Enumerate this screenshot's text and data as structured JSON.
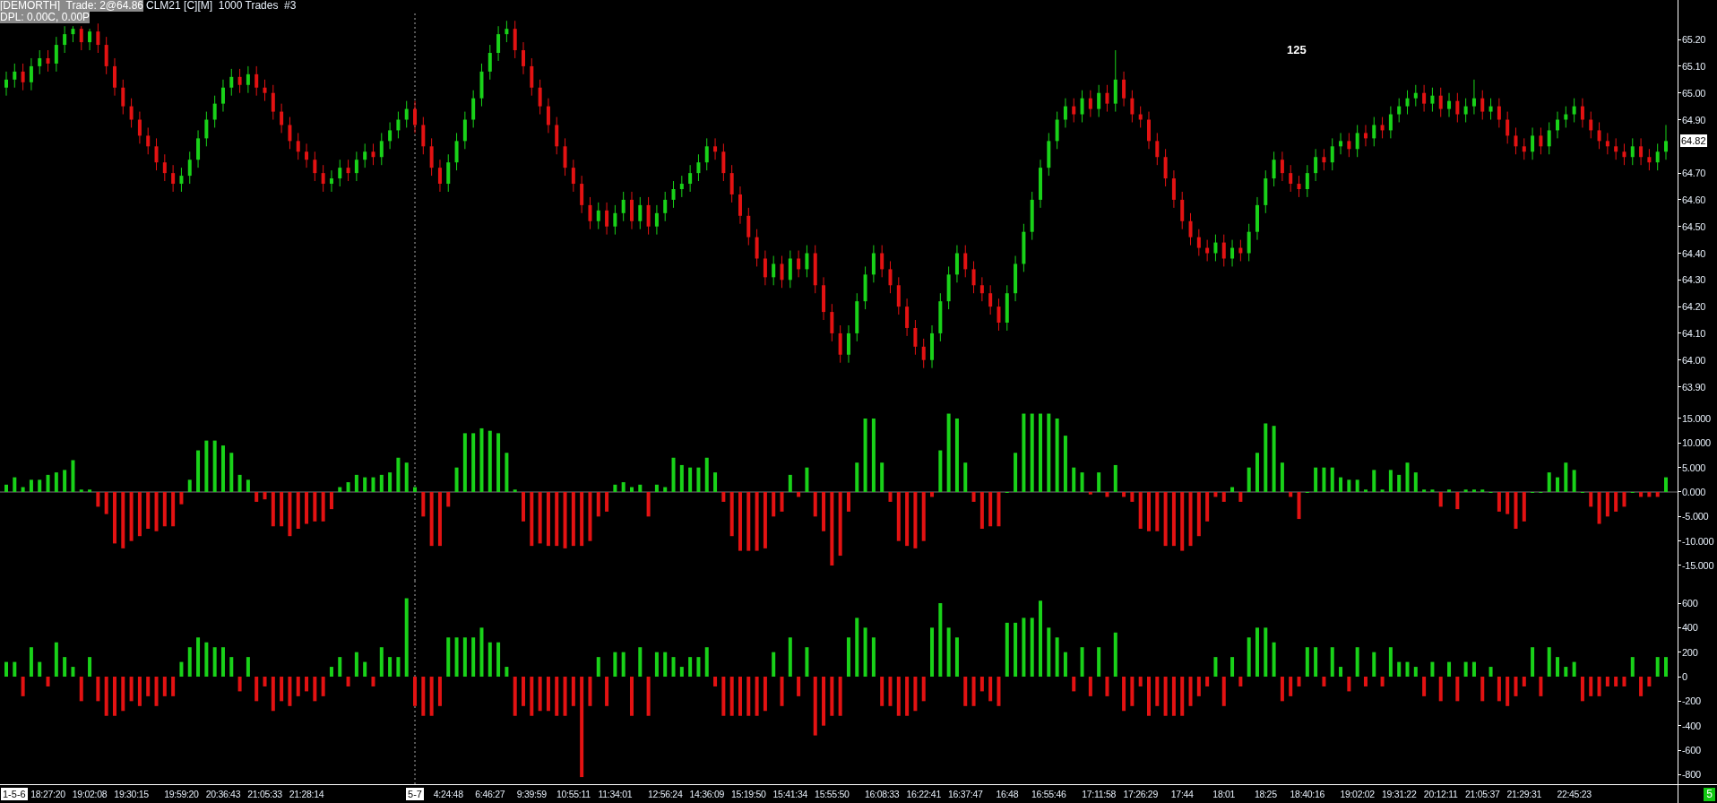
{
  "header": {
    "account_trade": "[DEMORTH]  Trade: 2@64.86",
    "symbol_info": "CLM21 [C][M]  1000 Trades  #3",
    "dpl": "DPL: 0.00C, 0.00P"
  },
  "bar_counter": "125",
  "price_pane": {
    "current_price": "64.82",
    "chart_data": {
      "type": "candlestick",
      "ylim": [
        63.885,
        65.348
      ],
      "yticks": [
        {
          "value": 65.2,
          "label": "65.20"
        },
        {
          "value": 65.1,
          "label": "65.10"
        },
        {
          "value": 65.0,
          "label": "65.00"
        },
        {
          "value": 64.9,
          "label": "64.90"
        },
        {
          "value": 64.7,
          "label": "64.70"
        },
        {
          "value": 64.6,
          "label": "64.60"
        },
        {
          "value": 64.5,
          "label": "64.50"
        },
        {
          "value": 64.4,
          "label": "64.40"
        },
        {
          "value": 64.3,
          "label": "64.30"
        },
        {
          "value": 64.2,
          "label": "64.20"
        },
        {
          "value": 64.1,
          "label": "64.10"
        },
        {
          "value": 64.0,
          "label": "64.00"
        },
        {
          "value": 63.9,
          "label": "63.90"
        }
      ],
      "categories": [
        null,
        null,
        null,
        null,
        null,
        null,
        null,
        null,
        null,
        null,
        null,
        null,
        null,
        null,
        null,
        null,
        null,
        null,
        null,
        null,
        null,
        null,
        null,
        null,
        null,
        null,
        null,
        null,
        null,
        null,
        null,
        null,
        null,
        null,
        null,
        null,
        null,
        null,
        null,
        null,
        null,
        null,
        null,
        null,
        null,
        null,
        null,
        null,
        null,
        null,
        null,
        null,
        null,
        null,
        null,
        null,
        null,
        null,
        null,
        null,
        null,
        null,
        null,
        null,
        null,
        null,
        null,
        null,
        null,
        null,
        null,
        null,
        null,
        null,
        null,
        null,
        null,
        null,
        null,
        null,
        null,
        null,
        null,
        null,
        null,
        null,
        null,
        null,
        null,
        null,
        null,
        null,
        null,
        null,
        null,
        null,
        null,
        null,
        null,
        null,
        null,
        null,
        null,
        null,
        null,
        null,
        null,
        null,
        null,
        null,
        null,
        null,
        null,
        null,
        null,
        null,
        null,
        null,
        null,
        null,
        null,
        null,
        null,
        null,
        null,
        null,
        null,
        null,
        null,
        null,
        null,
        null,
        null,
        null,
        null,
        null,
        null,
        null,
        null,
        null,
        null,
        null,
        null,
        null,
        null,
        null,
        null,
        null,
        null,
        null,
        null,
        null,
        null,
        null,
        null,
        null,
        null,
        null,
        null,
        null,
        null,
        null,
        null,
        null,
        null,
        null,
        null,
        null,
        null,
        null,
        null,
        null,
        null,
        null,
        null,
        null,
        null,
        null,
        null,
        null,
        null,
        null,
        null,
        null,
        null,
        null,
        null,
        null,
        null,
        null,
        null,
        null,
        null,
        null,
        null,
        null,
        null,
        null,
        null,
        null
      ],
      "ohlc": [
        [
          65.02,
          65.08,
          64.99,
          65.05
        ],
        [
          65.05,
          65.11,
          65.02,
          65.08
        ],
        [
          65.08,
          65.11,
          65.01,
          65.04
        ],
        [
          65.04,
          65.13,
          65.01,
          65.1
        ],
        [
          65.1,
          65.16,
          65.07,
          65.13
        ],
        [
          65.13,
          65.16,
          65.08,
          65.11
        ],
        [
          65.11,
          65.21,
          65.08,
          65.18
        ],
        [
          65.18,
          65.25,
          65.15,
          65.22
        ],
        [
          65.22,
          65.25,
          65.19,
          65.24
        ],
        [
          65.24,
          65.25,
          65.16,
          65.19
        ],
        [
          65.19,
          65.24,
          65.16,
          65.23
        ],
        [
          65.23,
          65.26,
          65.15,
          65.18
        ],
        [
          65.18,
          65.21,
          65.07,
          65.1
        ],
        [
          65.1,
          65.13,
          64.99,
          65.02
        ],
        [
          65.02,
          65.05,
          64.92,
          64.95
        ],
        [
          64.95,
          64.98,
          64.87,
          64.9
        ],
        [
          64.9,
          64.93,
          64.81,
          64.84
        ],
        [
          64.84,
          64.87,
          64.77,
          64.8
        ],
        [
          64.8,
          64.83,
          64.71,
          64.74
        ],
        [
          64.74,
          64.77,
          64.67,
          64.7
        ],
        [
          64.7,
          64.73,
          64.63,
          64.66
        ],
        [
          64.66,
          64.72,
          64.63,
          64.69
        ],
        [
          64.69,
          64.78,
          64.66,
          64.75
        ],
        [
          64.75,
          64.86,
          64.72,
          64.83
        ],
        [
          64.83,
          64.93,
          64.8,
          64.9
        ],
        [
          64.9,
          64.99,
          64.87,
          64.96
        ],
        [
          64.96,
          65.05,
          64.93,
          65.02
        ],
        [
          65.02,
          65.09,
          64.99,
          65.06
        ],
        [
          65.06,
          65.09,
          65.0,
          65.03
        ],
        [
          65.03,
          65.1,
          65.0,
          65.07
        ],
        [
          65.07,
          65.1,
          64.99,
          65.02
        ],
        [
          65.02,
          65.05,
          64.97,
          65.0
        ],
        [
          65.0,
          65.03,
          64.9,
          64.93
        ],
        [
          64.93,
          64.96,
          64.85,
          64.88
        ],
        [
          64.88,
          64.91,
          64.79,
          64.82
        ],
        [
          64.82,
          64.85,
          64.75,
          64.78
        ],
        [
          64.78,
          64.81,
          64.72,
          64.75
        ],
        [
          64.75,
          64.78,
          64.67,
          64.7
        ],
        [
          64.7,
          64.73,
          64.63,
          64.66
        ],
        [
          64.66,
          64.71,
          64.63,
          64.68
        ],
        [
          64.68,
          64.75,
          64.65,
          64.72
        ],
        [
          64.72,
          64.75,
          64.67,
          64.7
        ],
        [
          64.7,
          64.78,
          64.67,
          64.75
        ],
        [
          64.75,
          64.81,
          64.72,
          64.78
        ],
        [
          64.78,
          64.81,
          64.73,
          64.76
        ],
        [
          64.76,
          64.85,
          64.73,
          64.82
        ],
        [
          64.82,
          64.89,
          64.79,
          64.86
        ],
        [
          64.86,
          64.93,
          64.83,
          64.9
        ],
        [
          64.9,
          64.97,
          64.87,
          64.94
        ],
        [
          64.94,
          64.97,
          64.85,
          64.88
        ],
        [
          64.88,
          64.91,
          64.77,
          64.8
        ],
        [
          64.8,
          64.83,
          64.69,
          64.72
        ],
        [
          64.72,
          64.75,
          64.63,
          64.66
        ],
        [
          64.66,
          64.77,
          64.63,
          64.74
        ],
        [
          64.74,
          64.85,
          64.71,
          64.82
        ],
        [
          64.82,
          64.93,
          64.79,
          64.9
        ],
        [
          64.9,
          65.01,
          64.87,
          64.98
        ],
        [
          64.98,
          65.11,
          64.95,
          65.08
        ],
        [
          65.08,
          65.18,
          65.05,
          65.15
        ],
        [
          65.15,
          65.25,
          65.12,
          65.22
        ],
        [
          65.22,
          65.27,
          65.19,
          65.24
        ],
        [
          65.24,
          65.27,
          65.13,
          65.16
        ],
        [
          65.16,
          65.19,
          65.07,
          65.1
        ],
        [
          65.1,
          65.13,
          64.99,
          65.02
        ],
        [
          65.02,
          65.05,
          64.92,
          64.95
        ],
        [
          64.95,
          64.98,
          64.85,
          64.88
        ],
        [
          64.88,
          64.91,
          64.77,
          64.8
        ],
        [
          64.8,
          64.83,
          64.69,
          64.72
        ],
        [
          64.72,
          64.75,
          64.63,
          64.66
        ],
        [
          64.66,
          64.69,
          64.55,
          64.58
        ],
        [
          64.58,
          64.61,
          64.49,
          64.52
        ],
        [
          64.52,
          64.59,
          64.49,
          64.56
        ],
        [
          64.56,
          64.59,
          64.47,
          64.5
        ],
        [
          64.5,
          64.58,
          64.47,
          64.55
        ],
        [
          64.55,
          64.63,
          64.52,
          64.6
        ],
        [
          64.6,
          64.63,
          64.49,
          64.52
        ],
        [
          64.52,
          64.61,
          64.49,
          64.58
        ],
        [
          64.58,
          64.61,
          64.47,
          64.5
        ],
        [
          64.5,
          64.58,
          64.47,
          64.55
        ],
        [
          64.55,
          64.63,
          64.52,
          64.6
        ],
        [
          64.6,
          64.67,
          64.57,
          64.64
        ],
        [
          64.64,
          64.69,
          64.61,
          64.66
        ],
        [
          64.66,
          64.73,
          64.63,
          64.7
        ],
        [
          64.7,
          64.77,
          64.67,
          64.74
        ],
        [
          64.74,
          64.83,
          64.71,
          64.8
        ],
        [
          64.8,
          64.83,
          64.75,
          64.78
        ],
        [
          64.78,
          64.81,
          64.67,
          64.7
        ],
        [
          64.7,
          64.73,
          64.59,
          64.62
        ],
        [
          64.62,
          64.65,
          64.51,
          64.54
        ],
        [
          64.54,
          64.57,
          64.43,
          64.46
        ],
        [
          64.46,
          64.49,
          64.35,
          64.38
        ],
        [
          64.38,
          64.41,
          64.28,
          64.31
        ],
        [
          64.31,
          64.39,
          64.28,
          64.36
        ],
        [
          64.36,
          64.39,
          64.27,
          64.3
        ],
        [
          64.3,
          64.41,
          64.27,
          64.38
        ],
        [
          64.38,
          64.41,
          64.31,
          64.34
        ],
        [
          64.34,
          64.43,
          64.31,
          64.4
        ],
        [
          64.4,
          64.43,
          64.25,
          64.28
        ],
        [
          64.28,
          64.31,
          64.15,
          64.18
        ],
        [
          64.18,
          64.21,
          64.07,
          64.1
        ],
        [
          64.1,
          64.13,
          63.99,
          64.02
        ],
        [
          64.02,
          64.13,
          63.99,
          64.1
        ],
        [
          64.1,
          64.25,
          64.07,
          64.22
        ],
        [
          64.22,
          64.35,
          64.19,
          64.32
        ],
        [
          64.32,
          64.43,
          64.29,
          64.4
        ],
        [
          64.4,
          64.43,
          64.31,
          64.34
        ],
        [
          64.34,
          64.37,
          64.25,
          64.28
        ],
        [
          64.28,
          64.31,
          64.17,
          64.2
        ],
        [
          64.2,
          64.23,
          64.09,
          64.12
        ],
        [
          64.12,
          64.15,
          64.02,
          64.05
        ],
        [
          64.05,
          64.08,
          63.97,
          64.0
        ],
        [
          64.0,
          64.13,
          63.97,
          64.1
        ],
        [
          64.1,
          64.25,
          64.07,
          64.22
        ],
        [
          64.22,
          64.35,
          64.19,
          64.32
        ],
        [
          64.32,
          64.43,
          64.29,
          64.4
        ],
        [
          64.4,
          64.43,
          64.31,
          64.34
        ],
        [
          64.34,
          64.37,
          64.25,
          64.28
        ],
        [
          64.28,
          64.31,
          64.22,
          64.25
        ],
        [
          64.25,
          64.28,
          64.17,
          64.2
        ],
        [
          64.2,
          64.23,
          64.11,
          64.14
        ],
        [
          64.14,
          64.28,
          64.11,
          64.25
        ],
        [
          64.25,
          64.39,
          64.22,
          64.36
        ],
        [
          64.36,
          64.51,
          64.33,
          64.48
        ],
        [
          64.48,
          64.63,
          64.45,
          64.6
        ],
        [
          64.6,
          64.75,
          64.57,
          64.72
        ],
        [
          64.72,
          64.85,
          64.69,
          64.82
        ],
        [
          64.82,
          64.93,
          64.79,
          64.9
        ],
        [
          64.9,
          64.98,
          64.87,
          64.95
        ],
        [
          64.95,
          64.98,
          64.89,
          64.92
        ],
        [
          64.92,
          65.01,
          64.89,
          64.98
        ],
        [
          64.98,
          65.01,
          64.91,
          64.94
        ],
        [
          64.94,
          65.03,
          64.91,
          65.0
        ],
        [
          65.0,
          65.03,
          64.93,
          64.96
        ],
        [
          64.96,
          65.16,
          64.93,
          65.05
        ],
        [
          65.05,
          65.08,
          64.95,
          64.98
        ],
        [
          64.98,
          65.01,
          64.89,
          64.92
        ],
        [
          64.92,
          64.95,
          64.87,
          64.9
        ],
        [
          64.9,
          64.93,
          64.79,
          64.82
        ],
        [
          64.82,
          64.85,
          64.73,
          64.76
        ],
        [
          64.76,
          64.79,
          64.65,
          64.68
        ],
        [
          64.68,
          64.71,
          64.57,
          64.6
        ],
        [
          64.6,
          64.63,
          64.49,
          64.52
        ],
        [
          64.52,
          64.55,
          64.43,
          64.46
        ],
        [
          64.46,
          64.49,
          64.39,
          64.42
        ],
        [
          64.42,
          64.45,
          64.37,
          64.4
        ],
        [
          64.4,
          64.47,
          64.37,
          64.44
        ],
        [
          64.44,
          64.47,
          64.35,
          64.38
        ],
        [
          64.38,
          64.45,
          64.35,
          64.42
        ],
        [
          64.42,
          64.45,
          64.37,
          64.4
        ],
        [
          64.4,
          64.51,
          64.37,
          64.48
        ],
        [
          64.48,
          64.61,
          64.45,
          64.58
        ],
        [
          64.58,
          64.71,
          64.55,
          64.68
        ],
        [
          64.68,
          64.78,
          64.65,
          64.75
        ],
        [
          64.75,
          64.78,
          64.67,
          64.7
        ],
        [
          64.7,
          64.73,
          64.63,
          64.66
        ],
        [
          64.66,
          64.69,
          64.61,
          64.64
        ],
        [
          64.64,
          64.73,
          64.61,
          64.7
        ],
        [
          64.7,
          64.79,
          64.67,
          64.76
        ],
        [
          64.76,
          64.79,
          64.71,
          64.74
        ],
        [
          64.74,
          64.83,
          64.71,
          64.8
        ],
        [
          64.8,
          64.85,
          64.77,
          64.82
        ],
        [
          64.82,
          64.85,
          64.76,
          64.79
        ],
        [
          64.79,
          64.88,
          64.76,
          64.85
        ],
        [
          64.85,
          64.88,
          64.8,
          64.83
        ],
        [
          64.83,
          64.91,
          64.8,
          64.88
        ],
        [
          64.88,
          64.91,
          64.83,
          64.86
        ],
        [
          64.86,
          64.95,
          64.83,
          64.92
        ],
        [
          64.92,
          64.98,
          64.89,
          64.95
        ],
        [
          64.95,
          65.01,
          64.92,
          64.98
        ],
        [
          64.98,
          65.03,
          64.95,
          65.0
        ],
        [
          65.0,
          65.03,
          64.93,
          64.96
        ],
        [
          64.96,
          65.02,
          64.93,
          64.99
        ],
        [
          64.99,
          65.02,
          64.91,
          64.94
        ],
        [
          64.94,
          65.0,
          64.91,
          64.97
        ],
        [
          64.97,
          65.0,
          64.89,
          64.92
        ],
        [
          64.92,
          64.98,
          64.89,
          64.95
        ],
        [
          64.95,
          65.05,
          64.92,
          64.98
        ],
        [
          64.98,
          65.01,
          64.9,
          64.93
        ],
        [
          64.93,
          64.98,
          64.9,
          64.95
        ],
        [
          64.95,
          64.98,
          64.87,
          64.9
        ],
        [
          64.9,
          64.93,
          64.81,
          64.84
        ],
        [
          64.84,
          64.87,
          64.77,
          64.8
        ],
        [
          64.8,
          64.83,
          64.75,
          64.78
        ],
        [
          64.78,
          64.87,
          64.75,
          64.84
        ],
        [
          64.84,
          64.87,
          64.77,
          64.8
        ],
        [
          64.8,
          64.89,
          64.77,
          64.86
        ],
        [
          64.86,
          64.93,
          64.83,
          64.9
        ],
        [
          64.9,
          64.95,
          64.87,
          64.92
        ],
        [
          64.92,
          64.98,
          64.89,
          64.95
        ],
        [
          64.95,
          64.98,
          64.87,
          64.9
        ],
        [
          64.9,
          64.93,
          64.83,
          64.86
        ],
        [
          64.86,
          64.89,
          64.79,
          64.82
        ],
        [
          64.82,
          64.85,
          64.77,
          64.8
        ],
        [
          64.8,
          64.83,
          64.75,
          64.78
        ],
        [
          64.78,
          64.81,
          64.73,
          64.76
        ],
        [
          64.76,
          64.83,
          64.73,
          64.8
        ],
        [
          64.8,
          64.83,
          64.73,
          64.76
        ],
        [
          64.76,
          64.79,
          64.71,
          64.74
        ],
        [
          64.74,
          64.81,
          64.71,
          64.78
        ],
        [
          64.78,
          64.88,
          64.75,
          64.82
        ]
      ]
    }
  },
  "delta_pane": {
    "chart_data": {
      "type": "bar",
      "ylim": [
        -18.11,
        20.67
      ],
      "yticks": [
        {
          "value": 15,
          "label": "15.000"
        },
        {
          "value": 10,
          "label": "10.000"
        },
        {
          "value": 5,
          "label": "5.000"
        },
        {
          "value": 0,
          "label": "0.000"
        },
        {
          "value": -5,
          "label": "-5.000"
        },
        {
          "value": -10,
          "label": "-10.000"
        },
        {
          "value": -15,
          "label": "-15.000"
        }
      ],
      "categories": [
        null,
        null,
        null,
        null,
        null,
        null,
        null,
        null,
        null,
        null,
        null,
        null,
        null,
        null,
        null,
        null,
        null,
        null,
        null,
        null,
        null,
        null,
        null,
        null,
        null,
        null,
        null,
        null,
        null,
        null,
        null,
        null,
        null,
        null,
        null,
        null,
        null,
        null,
        null,
        null,
        null,
        null,
        null,
        null,
        null,
        null,
        null,
        null,
        null,
        null,
        null,
        null,
        null,
        null,
        null,
        null,
        null,
        null,
        null,
        null,
        null,
        null,
        null,
        null,
        null,
        null,
        null,
        null,
        null,
        null,
        null,
        null,
        null,
        null,
        null,
        null,
        null,
        null,
        null,
        null,
        null,
        null,
        null,
        null,
        null,
        null,
        null,
        null,
        null,
        null,
        null,
        null,
        null,
        null,
        null,
        null,
        null,
        null,
        null,
        null,
        null,
        null,
        null,
        null,
        null,
        null,
        null,
        null,
        null,
        null,
        null,
        null,
        null,
        null,
        null,
        null,
        null,
        null,
        null,
        null,
        null,
        null,
        null,
        null,
        null,
        null,
        null,
        null,
        null,
        null,
        null,
        null,
        null,
        null,
        null,
        null,
        null,
        null,
        null,
        null,
        null,
        null,
        null,
        null,
        null,
        null,
        null,
        null,
        null,
        null,
        null,
        null,
        null,
        null,
        null,
        null,
        null,
        null,
        null,
        null,
        null,
        null,
        null,
        null,
        null,
        null,
        null,
        null,
        null,
        null,
        null,
        null,
        null,
        null,
        null,
        null,
        null,
        null,
        null,
        null,
        null,
        null,
        null,
        null,
        null,
        null,
        null,
        null,
        null,
        null,
        null,
        null,
        null,
        null,
        null,
        null,
        null,
        null,
        null,
        null
      ],
      "values": [
        1.5,
        3,
        1,
        2.5,
        2.5,
        3.5,
        4,
        4.5,
        6.5,
        0.5,
        0.5,
        -3,
        -4.5,
        -10.5,
        -11.5,
        -10,
        -9,
        -7.5,
        -8,
        -7,
        -7,
        -2.5,
        2.5,
        8.5,
        10.5,
        10.5,
        9.5,
        8,
        3.5,
        2.5,
        -2,
        -1.5,
        -7,
        -7,
        -9,
        -7.5,
        -6.5,
        -6,
        -6,
        -3.5,
        1,
        2,
        3.5,
        3,
        3,
        3.5,
        4,
        7,
        6,
        1,
        -5,
        -11,
        -11,
        -3,
        5,
        12,
        12,
        13,
        12.5,
        12,
        8,
        0.5,
        -6,
        -11,
        -10.5,
        -11,
        -11,
        -11.5,
        -11,
        -11,
        -10,
        -5,
        -4,
        1.5,
        2,
        1,
        1.5,
        -5,
        1.5,
        1,
        7,
        5.5,
        5,
        5,
        7,
        4,
        -2,
        -9,
        -12,
        -12,
        -12,
        -11.5,
        -5,
        -4,
        3.5,
        -1,
        5,
        -5,
        -8,
        -15,
        -13,
        -4,
        6,
        15,
        15,
        6,
        -2,
        -10,
        -11,
        -11.5,
        -10,
        -1,
        8.5,
        16,
        15,
        6,
        -2,
        -7.5,
        -7,
        -7,
        0,
        8,
        16,
        16,
        16,
        16,
        15,
        11.5,
        5,
        4,
        -0.5,
        4,
        -1,
        5.5,
        -1,
        -2,
        -7.5,
        -8,
        -8,
        -11,
        -11,
        -12,
        -11,
        -9,
        -6,
        -1,
        -2,
        1,
        -2,
        5,
        8,
        14,
        13.5,
        6,
        -1,
        -5.5,
        0,
        5,
        5,
        5,
        3,
        2.5,
        2.5,
        0.5,
        4.5,
        0.5,
        4.5,
        3.5,
        6,
        4,
        0.5,
        0.5,
        -3,
        0.5,
        -3.5,
        0.5,
        0.5,
        0.5,
        0,
        -4,
        -4.5,
        -7.5,
        -6,
        0,
        0,
        4,
        3,
        6,
        4.5,
        0,
        -3,
        -6.5,
        -5,
        -4,
        -3,
        0,
        -1,
        -1,
        -1,
        3
      ]
    }
  },
  "volume_pane": {
    "chart_data": {
      "type": "bar",
      "ylim": [
        -878,
        783
      ],
      "yticks": [
        {
          "value": 600,
          "label": "600"
        },
        {
          "value": 400,
          "label": "400"
        },
        {
          "value": 200,
          "label": "200"
        },
        {
          "value": 0,
          "label": "0"
        },
        {
          "value": -200,
          "label": "-200"
        },
        {
          "value": -400,
          "label": "-400"
        },
        {
          "value": -600,
          "label": "-600"
        },
        {
          "value": -800,
          "label": "-800"
        }
      ],
      "categories": [
        null,
        null,
        null,
        null,
        null,
        "18:27:20",
        null,
        null,
        null,
        null,
        "19:02:08",
        null,
        null,
        null,
        null,
        "19:30:15",
        null,
        null,
        null,
        null,
        null,
        "19:59:20",
        null,
        null,
        null,
        null,
        "20:36:43",
        null,
        null,
        null,
        null,
        "21:05:33",
        null,
        null,
        null,
        null,
        "21:28:14",
        null,
        null,
        null,
        null,
        null,
        null,
        null,
        null,
        null,
        null,
        null,
        null,
        null,
        null,
        null,
        null,
        "4:24:48",
        null,
        null,
        null,
        null,
        "6:46:27",
        null,
        null,
        null,
        null,
        "9:39:59",
        null,
        null,
        null,
        null,
        "10:55:11",
        null,
        null,
        null,
        null,
        "11:34:01",
        null,
        null,
        null,
        null,
        null,
        "12:56:24",
        null,
        null,
        null,
        null,
        "14:36:09",
        null,
        null,
        null,
        null,
        "15:19:50",
        null,
        null,
        null,
        null,
        "15:41:34",
        null,
        null,
        null,
        null,
        "15:55:50",
        null,
        null,
        null,
        null,
        null,
        "16:08:33",
        null,
        null,
        null,
        null,
        "16:22:41",
        null,
        null,
        null,
        null,
        "16:37:47",
        null,
        null,
        null,
        null,
        "16:48",
        null,
        null,
        null,
        null,
        "16:55:46",
        null,
        null,
        null,
        null,
        null,
        "17:11:58",
        null,
        null,
        null,
        null,
        "17:26:29",
        null,
        null,
        null,
        null,
        "17:44",
        null,
        null,
        null,
        null,
        "18:01",
        null,
        null,
        null,
        null,
        "18:25",
        null,
        null,
        null,
        null,
        "18:40:16",
        null,
        null,
        null,
        null,
        null,
        "19:02:02",
        null,
        null,
        null,
        null,
        "19:31:22",
        null,
        null,
        null,
        null,
        "20:12:11",
        null,
        null,
        null,
        null,
        "21:05:37",
        null,
        null,
        null,
        null,
        "21:29:31",
        null,
        null,
        null,
        null,
        null,
        "22:45:23",
        null,
        null,
        null,
        null,
        null,
        null,
        null,
        null,
        null,
        null,
        null
      ],
      "values": [
        120,
        120,
        -160,
        240,
        120,
        -80,
        280,
        160,
        80,
        -200,
        160,
        -200,
        -320,
        -320,
        -280,
        -200,
        -240,
        -160,
        -240,
        -160,
        -160,
        120,
        240,
        320,
        280,
        240,
        240,
        160,
        -120,
        160,
        -200,
        -80,
        -280,
        -200,
        -240,
        -160,
        -120,
        -200,
        -160,
        80,
        160,
        -80,
        200,
        120,
        -80,
        240,
        160,
        160,
        640,
        -240,
        -320,
        -320,
        -240,
        320,
        320,
        320,
        320,
        400,
        280,
        280,
        80,
        -320,
        -240,
        -320,
        -280,
        -280,
        -320,
        -320,
        -240,
        -820,
        -240,
        160,
        -240,
        200,
        200,
        -320,
        240,
        -320,
        200,
        200,
        160,
        80,
        160,
        160,
        240,
        -80,
        -320,
        -320,
        -320,
        -320,
        -320,
        -280,
        200,
        -240,
        320,
        -160,
        240,
        -480,
        -400,
        -320,
        -320,
        320,
        480,
        400,
        320,
        -240,
        -240,
        -320,
        -320,
        -280,
        -200,
        400,
        600,
        400,
        320,
        -240,
        -240,
        -120,
        -200,
        -240,
        440,
        440,
        480,
        480,
        620,
        400,
        320,
        200,
        -120,
        240,
        -160,
        240,
        -160,
        360,
        -280,
        -240,
        -80,
        -320,
        -240,
        -320,
        -320,
        -320,
        -240,
        -160,
        -80,
        160,
        -240,
        160,
        -80,
        320,
        400,
        400,
        280,
        -200,
        -160,
        -80,
        240,
        240,
        -80,
        240,
        80,
        -120,
        240,
        -80,
        200,
        -80,
        240,
        120,
        120,
        80,
        -160,
        120,
        -200,
        120,
        -200,
        120,
        120,
        -200,
        80,
        -200,
        -240,
        -160,
        -80,
        240,
        -160,
        240,
        160,
        80,
        120,
        -200,
        -160,
        -160,
        -80,
        -80,
        -80,
        160,
        -160,
        -80,
        160,
        160
      ]
    }
  },
  "time_axis": {
    "date_markers": [
      {
        "text": "1-5-6"
      },
      {
        "text": "5-7"
      }
    ]
  },
  "status_badge": "5"
}
